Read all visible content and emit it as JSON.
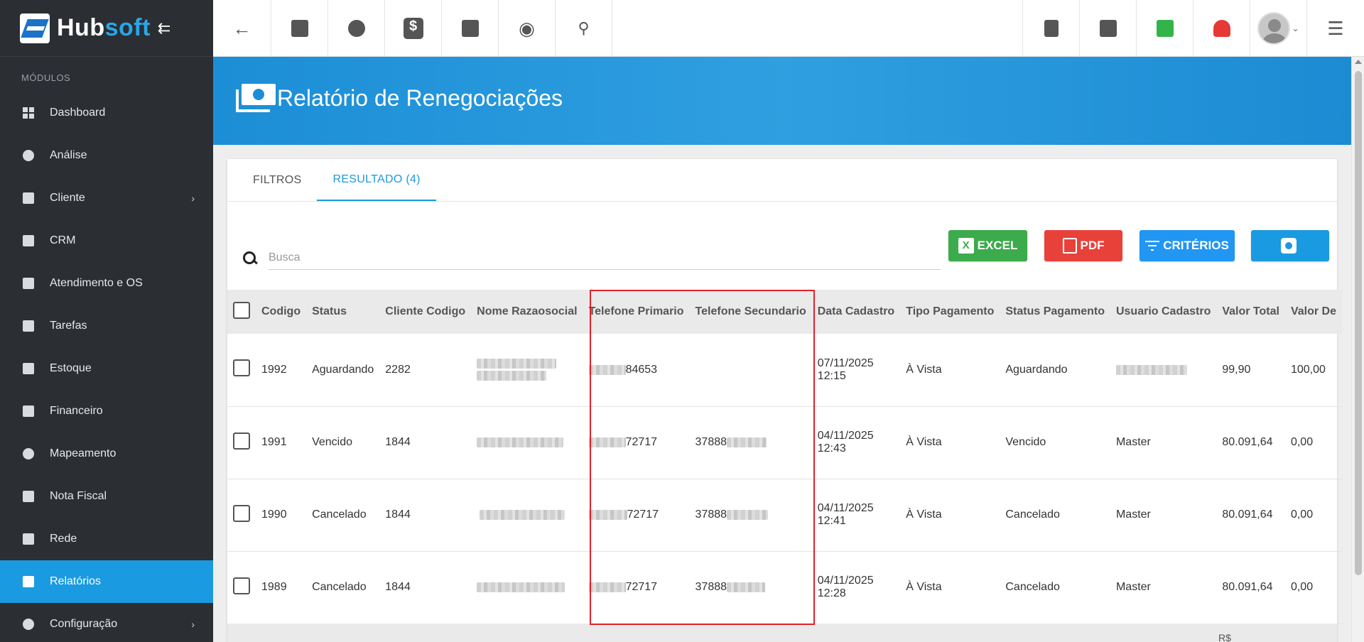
{
  "app": {
    "brand_hub": "Hub",
    "brand_soft": "soft",
    "modules_label": "MÓDULOS"
  },
  "sidebar": {
    "items": [
      {
        "label": "Dashboard",
        "icon": "dashboard-icon"
      },
      {
        "label": "Análise",
        "icon": "pie-chart-icon"
      },
      {
        "label": "Cliente",
        "icon": "contact-card-icon",
        "has_submenu": true
      },
      {
        "label": "CRM",
        "icon": "kanban-icon"
      },
      {
        "label": "Atendimento e OS",
        "icon": "calendar-clock-icon"
      },
      {
        "label": "Tarefas",
        "icon": "calendar-icon"
      },
      {
        "label": "Estoque",
        "icon": "box-icon"
      },
      {
        "label": "Financeiro",
        "icon": "money-icon"
      },
      {
        "label": "Mapeamento",
        "icon": "map-pin-icon"
      },
      {
        "label": "Nota Fiscal",
        "icon": "document-icon"
      },
      {
        "label": "Rede",
        "icon": "server-icon"
      },
      {
        "label": "Relatórios",
        "icon": "report-icon",
        "active": true
      },
      {
        "label": "Configuração",
        "icon": "gear-icon",
        "has_submenu": true
      }
    ]
  },
  "header": {
    "title": "Relatório de Renegociações"
  },
  "tabs": [
    {
      "label": "FILTROS"
    },
    {
      "label": "RESULTADO (4)",
      "active": true
    }
  ],
  "toolbar": {
    "search_placeholder": "Busca",
    "excel_label": "EXCEL",
    "pdf_label": "PDF",
    "criteria_label": "CRITÉRIOS"
  },
  "table": {
    "columns": [
      "Codigo",
      "Status",
      "Cliente Codigo",
      "Nome Razaosocial",
      "Telefone Primario",
      "Telefone Secundario",
      "Data Cadastro",
      "Tipo Pagamento",
      "Status Pagamento",
      "Usuario Cadastro",
      "Valor Total",
      "Valor De"
    ],
    "rows": [
      {
        "codigo": "1992",
        "status": "Aguardando",
        "cliente_codigo": "2282",
        "tel1_suffix": "84653",
        "tel2_prefix": "",
        "data": "07/11/2025",
        "hora": "12:15",
        "tipo": "À Vista",
        "status_pag": "Aguardando",
        "usuario": "",
        "valor_total": "99,90",
        "valor_de": "100,00"
      },
      {
        "codigo": "1991",
        "status": "Vencido",
        "cliente_codigo": "1844",
        "tel1_suffix": "72717",
        "tel2_prefix": "37888",
        "data": "04/11/2025",
        "hora": "12:43",
        "tipo": "À Vista",
        "status_pag": "Vencido",
        "usuario": "Master",
        "valor_total": "80.091,64",
        "valor_de": "0,00"
      },
      {
        "codigo": "1990",
        "status": "Cancelado",
        "cliente_codigo": "1844",
        "tel1_suffix": "72717",
        "tel2_prefix": "37888",
        "data": "04/11/2025",
        "hora": "12:41",
        "tipo": "À Vista",
        "status_pag": "Cancelado",
        "usuario": "Master",
        "valor_total": "80.091,64",
        "valor_de": "0,00"
      },
      {
        "codigo": "1989",
        "status": "Cancelado",
        "cliente_codigo": "1844",
        "tel1_suffix": "72717",
        "tel2_prefix": "37888",
        "data": "04/11/2025",
        "hora": "12:28",
        "tipo": "À Vista",
        "status_pag": "Cancelado",
        "usuario": "Master",
        "valor_total": "80.091,64",
        "valor_de": "0,00"
      }
    ],
    "footer_currency": "R$"
  },
  "colors": {
    "sidebar_bg": "#2b2e33",
    "accent": "#1a9ae1",
    "excel": "#3cab4b",
    "pdf": "#e8413a",
    "criteria": "#2196f3",
    "highlight": "#e0222a"
  }
}
